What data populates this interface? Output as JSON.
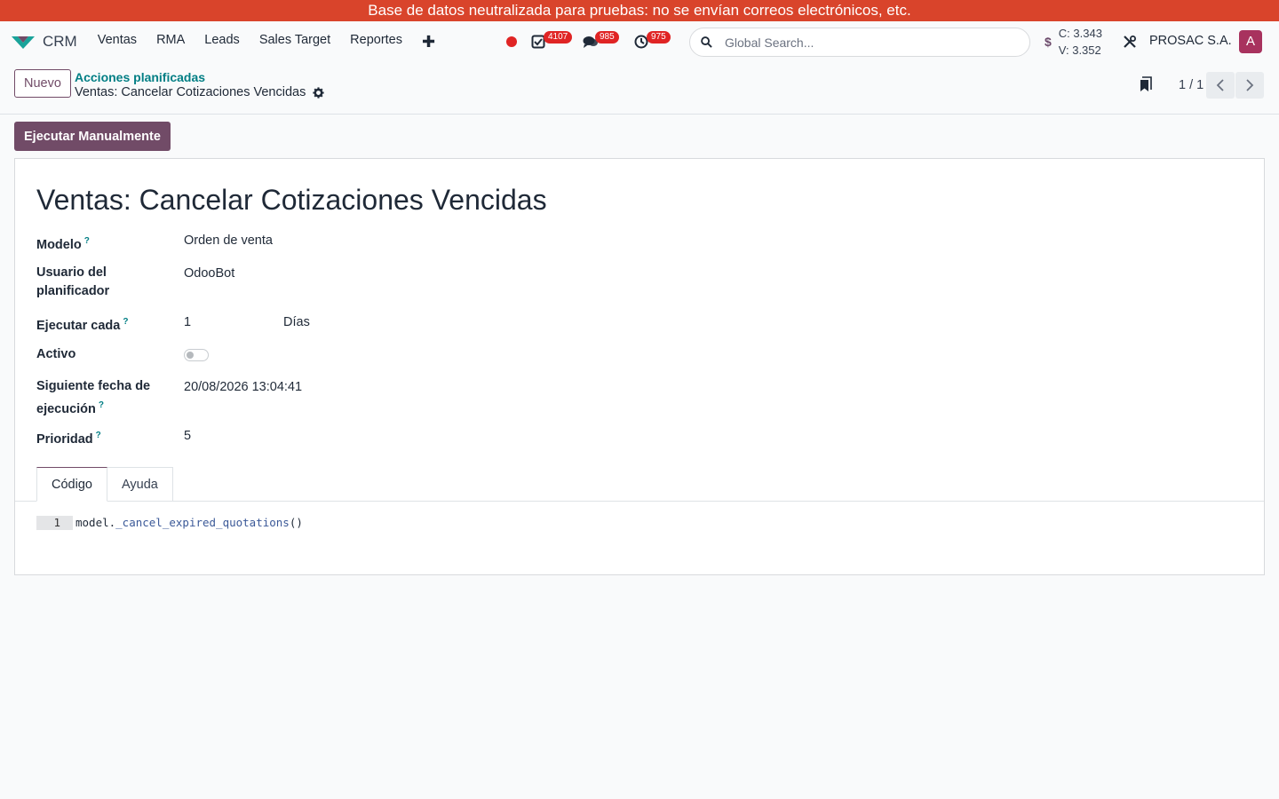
{
  "banner": {
    "text": "Base de datos neutralizada para pruebas: no se envían correos electrónicos, etc."
  },
  "navbar": {
    "app_name": "CRM",
    "menu": [
      "Ventas",
      "RMA",
      "Leads",
      "Sales Target",
      "Reportes"
    ],
    "badges": {
      "activities": "4107",
      "messages": "985",
      "timers": "975"
    },
    "search_placeholder": "Global Search...",
    "rates": {
      "currency_symbol": "$",
      "buy": "C: 3.343",
      "sell": "V: 3.352"
    },
    "company": "PROSAC S.A.",
    "avatar_letter": "A"
  },
  "control": {
    "new_label": "Nuevo",
    "breadcrumb_parent": "Acciones planificadas",
    "breadcrumb_current": "Ventas: Cancelar Cotizaciones Vencidas",
    "pager": "1 / 1"
  },
  "actions": {
    "run_label": "Ejecutar Manualmente"
  },
  "record": {
    "title": "Ventas: Cancelar Cotizaciones Vencidas",
    "fields": {
      "model_label": "Modelo",
      "model_value": "Orden de venta",
      "user_label_1": "Usuario del",
      "user_label_2": "planificador",
      "user_value": "OdooBot",
      "interval_label": "Ejecutar cada",
      "interval_number": "1",
      "interval_unit": "Días",
      "active_label": "Activo",
      "active_value": false,
      "nextcall_label_1": "Siguiente fecha de",
      "nextcall_label_2": "ejecución",
      "nextcall_value": "20/08/2026 13:04:41",
      "priority_label": "Prioridad",
      "priority_value": "5",
      "help_mark": "?"
    },
    "tabs": [
      "Código",
      "Ayuda"
    ],
    "code": {
      "line_number": "1",
      "object": "model.",
      "method": "_cancel_expired_quotations",
      "call": "()"
    }
  },
  "colors": {
    "banner": "#d9442b",
    "brand": "#714b67",
    "link": "#017e84",
    "badge": "#e02424",
    "avatar": "#a8325e"
  }
}
